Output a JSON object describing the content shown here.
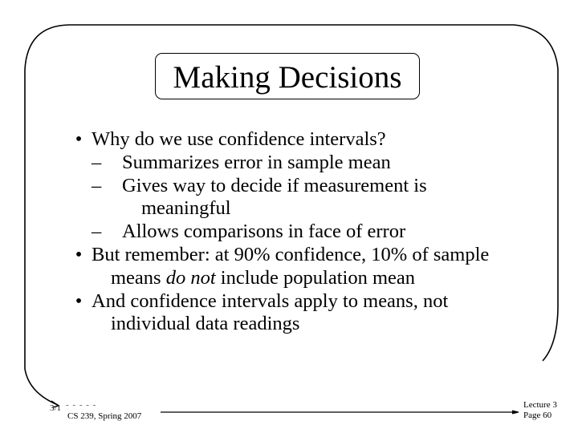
{
  "slide": {
    "title": "Making Decisions",
    "bullets": [
      {
        "text": "Why do we use confidence intervals?",
        "sub": [
          {
            "lines": [
              "Summarizes error in sample mean"
            ]
          },
          {
            "lines": [
              "Gives way to decide if measurement is",
              "meaningful"
            ]
          },
          {
            "lines": [
              "Allows comparisons in face of error"
            ]
          }
        ]
      },
      {
        "lines": [
          "But remember: at 90% confidence, 10% of sample"
        ],
        "cont_prefix": "means ",
        "cont_italic": "do not",
        "cont_suffix": " include population mean"
      },
      {
        "lines": [
          "And confidence intervals apply to means, not",
          "individual data readings"
        ]
      }
    ],
    "bullet_glyph": "•",
    "dash_glyph": "–"
  },
  "footer": {
    "date": "3/1",
    "date_dashes": "- - - - -",
    "course": "CS 239, Spring 2007",
    "lecture": "Lecture 3",
    "page": "Page 60"
  }
}
